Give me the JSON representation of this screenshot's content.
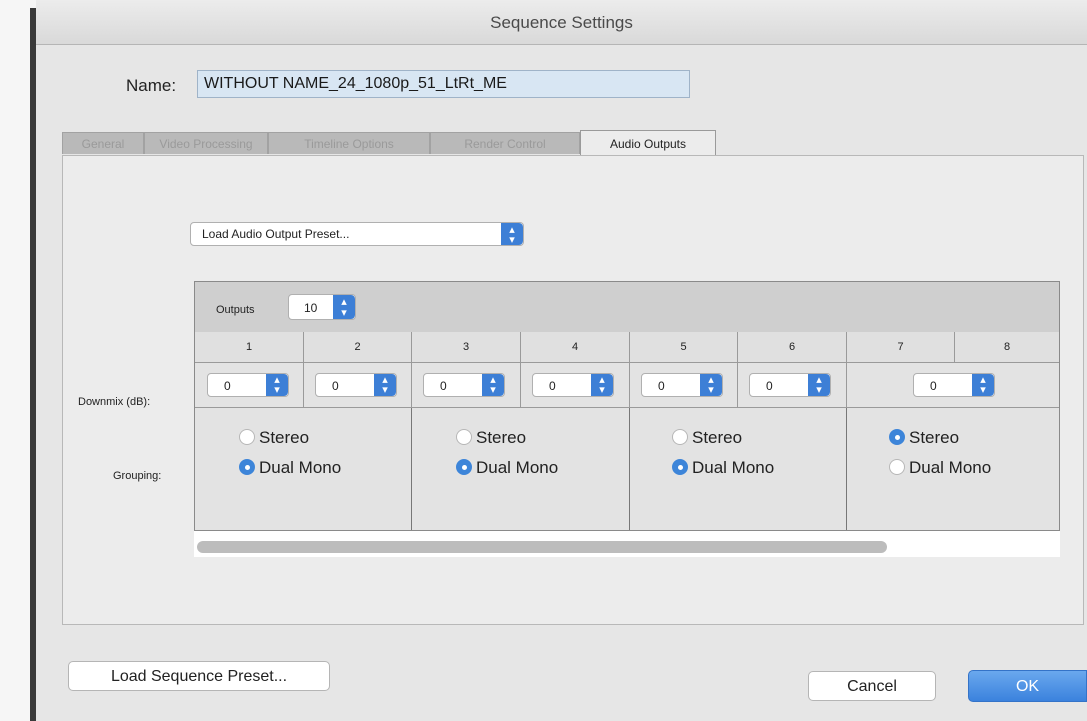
{
  "window": {
    "title": "Sequence Settings"
  },
  "name_field": {
    "label": "Name:",
    "value": "WITHOUT NAME_24_1080p_51_LtRt_ME"
  },
  "tabs": [
    {
      "label": "General"
    },
    {
      "label": "Video Processing"
    },
    {
      "label": "Timeline Options"
    },
    {
      "label": "Render Control"
    },
    {
      "label": "Audio Outputs",
      "active": true
    }
  ],
  "audio": {
    "preset_select": {
      "label": "Load Audio Output Preset..."
    },
    "outputs": {
      "label": "Outputs",
      "value": "10"
    },
    "channels": [
      "1",
      "2",
      "3",
      "4",
      "5",
      "6",
      "7",
      "8"
    ],
    "downmix_label": "Downmix (dB):",
    "downmix_values": [
      "0",
      "0",
      "0",
      "0",
      "0",
      "0",
      "0"
    ],
    "grouping_label": "Grouping:",
    "groups": [
      {
        "stereo": "Stereo",
        "dual": "Dual Mono",
        "selected": "dual"
      },
      {
        "stereo": "Stereo",
        "dual": "Dual Mono",
        "selected": "dual"
      },
      {
        "stereo": "Stereo",
        "dual": "Dual Mono",
        "selected": "dual"
      },
      {
        "stereo": "Stereo",
        "dual": "Dual Mono",
        "selected": "stereo"
      }
    ]
  },
  "buttons": {
    "load_preset": "Load Sequence Preset...",
    "cancel": "Cancel",
    "ok": "OK"
  },
  "colors": {
    "accent": "#3d85d9"
  }
}
